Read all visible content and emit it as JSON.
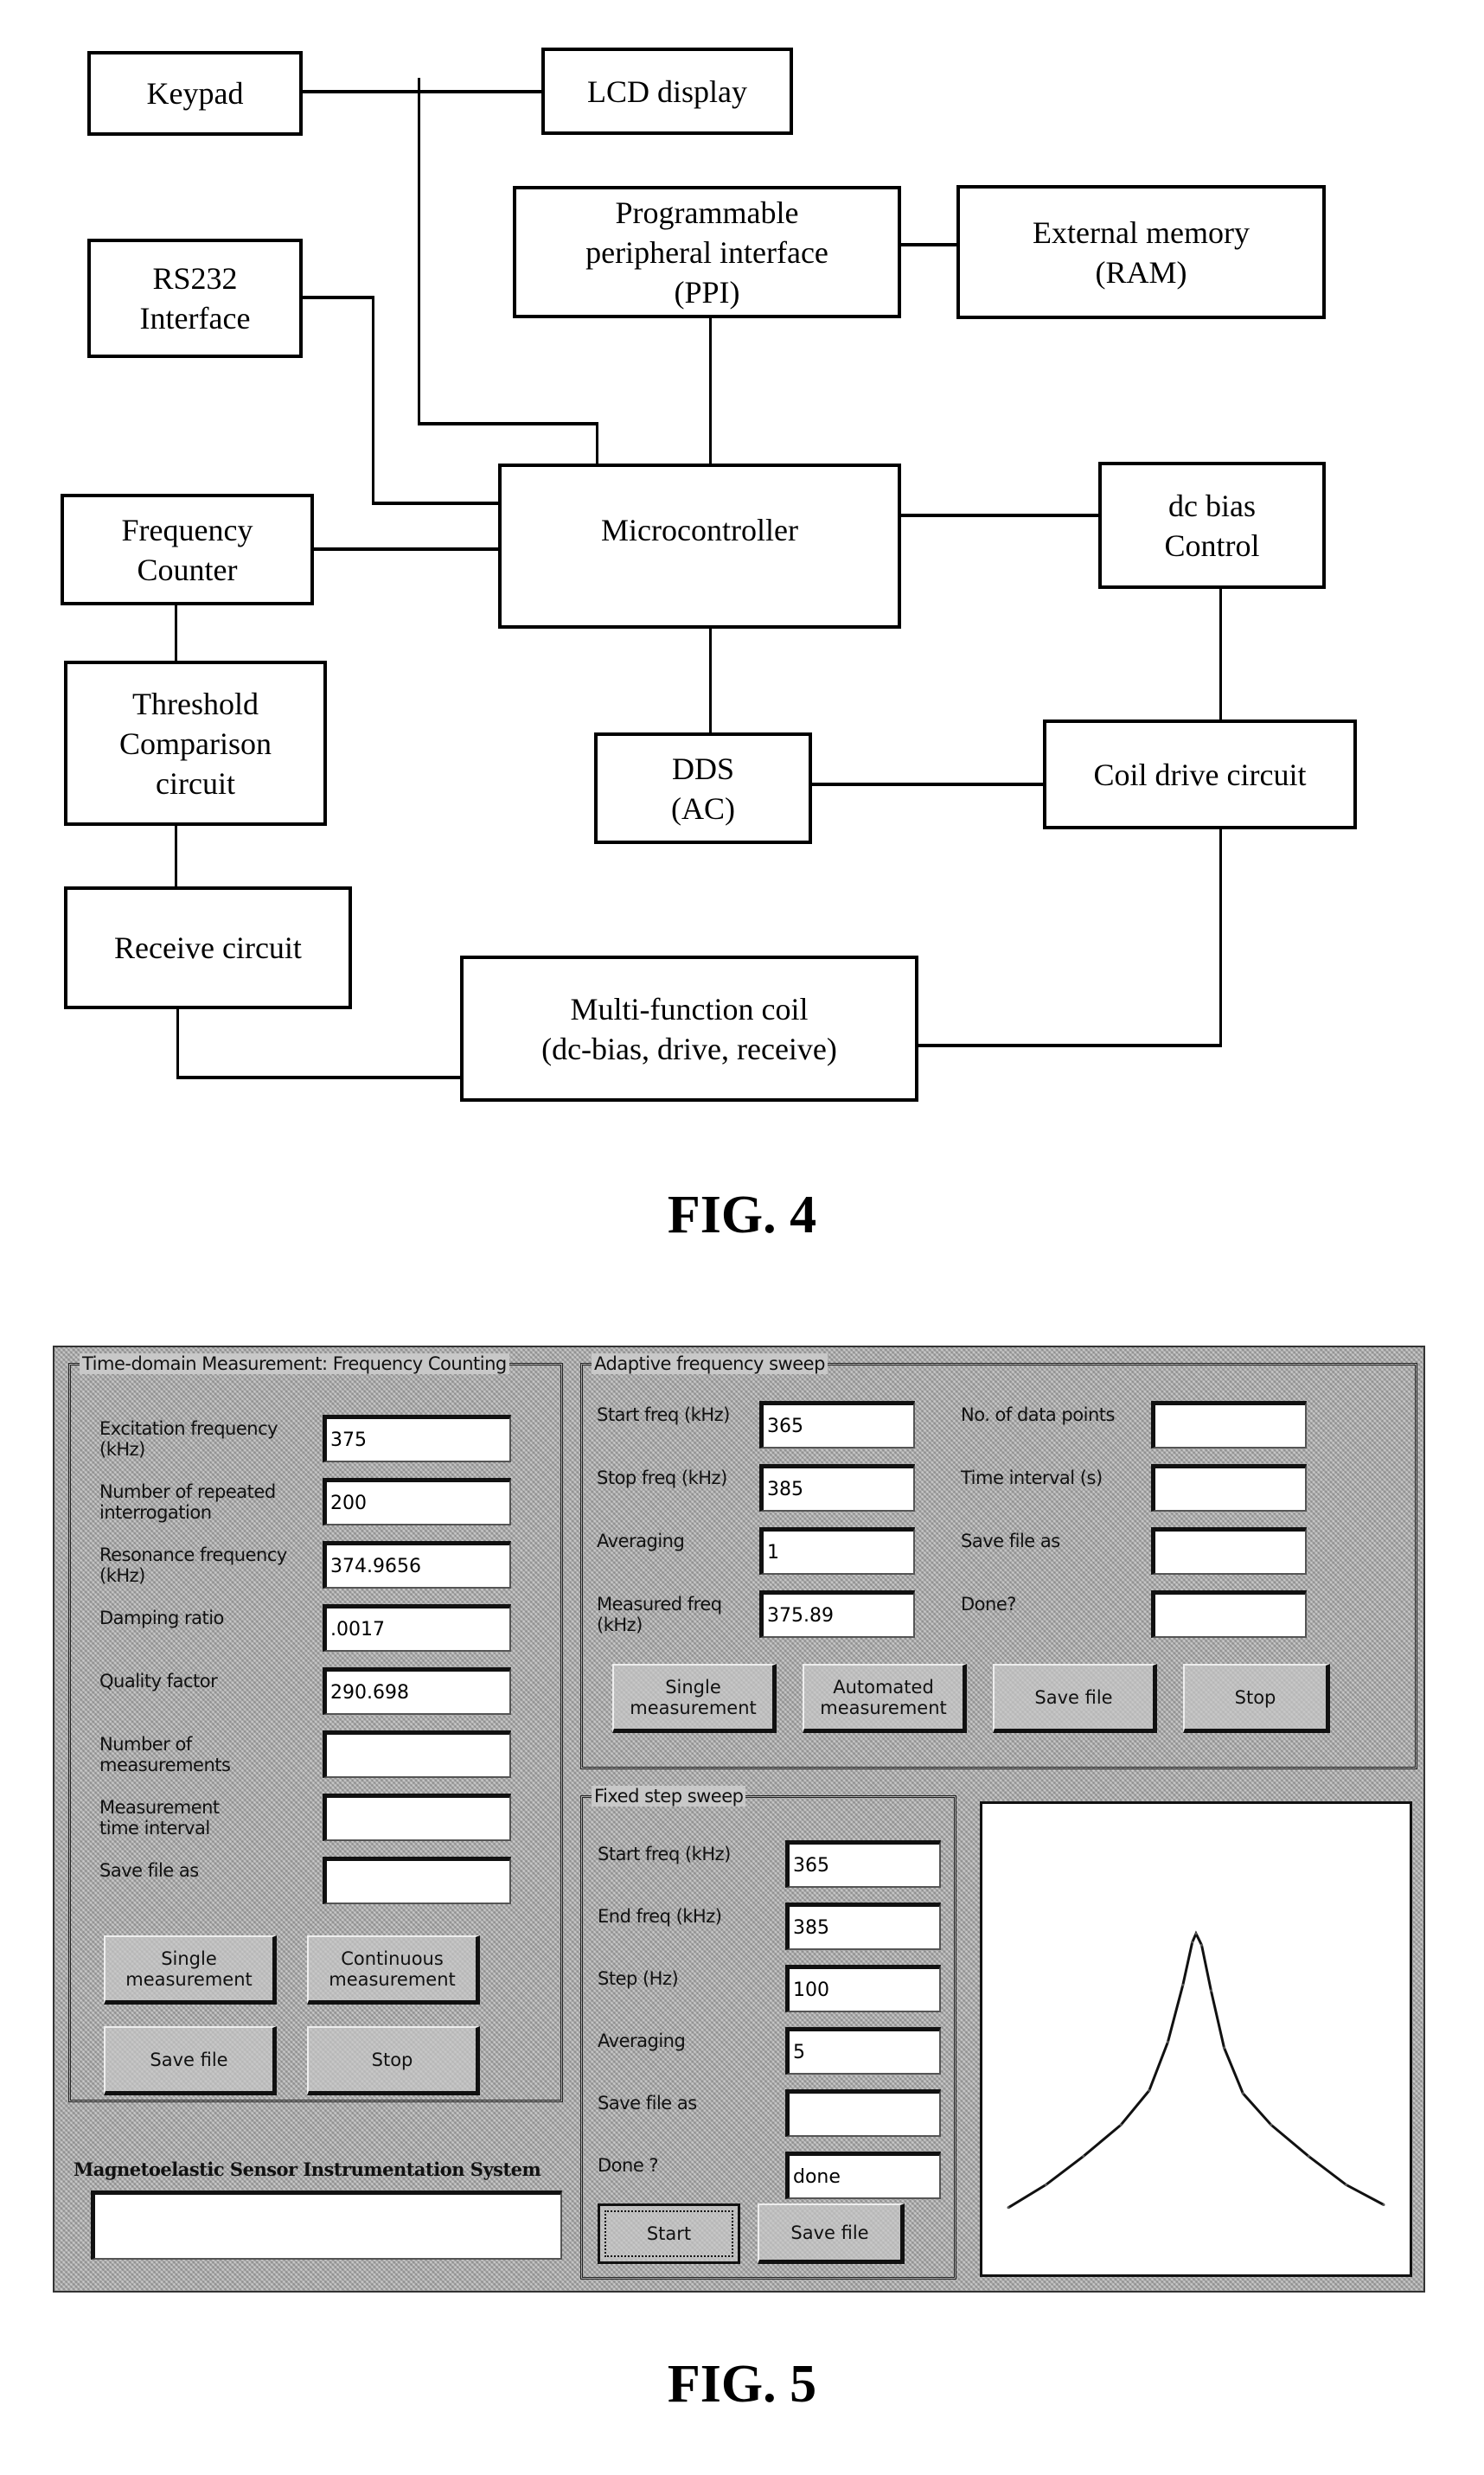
{
  "fig4": {
    "label": "FIG. 4",
    "blocks": {
      "keypad": "Keypad",
      "lcd": "LCD display",
      "ppi": "Programmable\nperipheral interface\n(PPI)",
      "ext_memory": "External memory\n(RAM)",
      "rs232": "RS232\nInterface",
      "microcontroller": "Microcontroller",
      "dc_bias": "dc bias\nControl",
      "freq_counter": "Frequency\nCounter",
      "threshold": "Threshold\nComparison\ncircuit",
      "dds": "DDS\n(AC)",
      "coil_drive": "Coil drive circuit",
      "receive": "Receive circuit",
      "coil": "Multi-function coil\n(dc-bias, drive, receive)"
    }
  },
  "fig5": {
    "label": "FIG. 5",
    "time_domain": {
      "title": "Time-domain Measurement: Frequency Counting",
      "fields": [
        {
          "label": "Excitation frequency\n(kHz)",
          "value": "375"
        },
        {
          "label": "Number of repeated\ninterrogation",
          "value": "200"
        },
        {
          "label": "Resonance frequency\n(kHz)",
          "value": "374.9656"
        },
        {
          "label": "Damping ratio",
          "value": ".0017"
        },
        {
          "label": "Quality factor",
          "value": "290.698"
        },
        {
          "label": "Number of\nmeasurements",
          "value": ""
        },
        {
          "label": "Measurement\ntime interval",
          "value": ""
        },
        {
          "label": "Save file as",
          "value": ""
        }
      ],
      "buttons": {
        "single": "Single\nmeasurement",
        "continuous": "Continuous\nmeasurement",
        "save": "Save file",
        "stop": "Stop"
      }
    },
    "app_title": "Magnetoelastic Sensor Instrumentation System",
    "status_value": "",
    "adaptive": {
      "title": "Adaptive frequency sweep",
      "left_fields": [
        {
          "label": "Start freq (kHz)",
          "value": "365"
        },
        {
          "label": "Stop freq (kHz)",
          "value": "385"
        },
        {
          "label": "Averaging",
          "value": "1"
        },
        {
          "label": "Measured freq\n(kHz)",
          "value": "375.89"
        }
      ],
      "right_fields": [
        {
          "label": "No. of data points",
          "value": ""
        },
        {
          "label": "Time interval (s)",
          "value": ""
        },
        {
          "label": "Save file as",
          "value": ""
        },
        {
          "label": "Done?",
          "value": ""
        }
      ],
      "buttons": {
        "single": "Single\nmeasurement",
        "automated": "Automated\nmeasurement",
        "save": "Save file",
        "stop": "Stop"
      }
    },
    "fixed_step": {
      "title": "Fixed step sweep",
      "fields": [
        {
          "label": "Start freq (kHz)",
          "value": "365"
        },
        {
          "label": "End freq (kHz)",
          "value": "385"
        },
        {
          "label": "Step (Hz)",
          "value": "100"
        },
        {
          "label": "Averaging",
          "value": "5"
        },
        {
          "label": "Save file as",
          "value": ""
        },
        {
          "label": "Done ?",
          "value": "done"
        }
      ],
      "buttons": {
        "start": "Start",
        "save": "Save file"
      }
    },
    "plot": {
      "type": "line",
      "description": "resonance peak",
      "x_range_khz": [
        365,
        385
      ],
      "peak_khz": 375.0,
      "curve": [
        [
          365,
          0.04
        ],
        [
          367,
          0.12
        ],
        [
          369,
          0.22
        ],
        [
          371,
          0.33
        ],
        [
          372.5,
          0.45
        ],
        [
          373.5,
          0.62
        ],
        [
          374.3,
          0.82
        ],
        [
          374.8,
          0.97
        ],
        [
          375,
          1.0
        ],
        [
          375.3,
          0.96
        ],
        [
          375.8,
          0.8
        ],
        [
          376.5,
          0.6
        ],
        [
          377.5,
          0.44
        ],
        [
          379,
          0.33
        ],
        [
          381,
          0.22
        ],
        [
          383,
          0.12
        ],
        [
          385,
          0.05
        ]
      ]
    }
  }
}
